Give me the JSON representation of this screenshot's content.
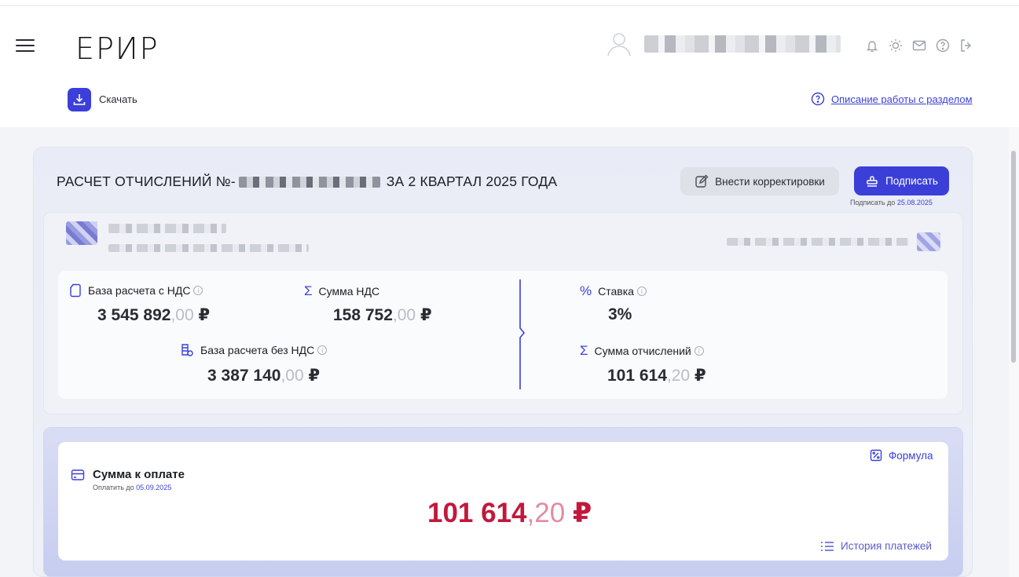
{
  "header": {
    "logo": "ЕРИР",
    "icons": [
      "bell-icon",
      "lightbulb-icon",
      "mail-icon",
      "help-icon",
      "logout-icon"
    ]
  },
  "actions": {
    "download_label": "Скачать",
    "help_link": "Описание работы с разделом"
  },
  "report": {
    "title_prefix": "РАСЧЕТ ОТЧИСЛЕНИЙ №-",
    "title_suffix": "ЗА 2 КВАРТАЛ 2025 ГОДА",
    "correct_button": "Внести корректировки",
    "sign_button": "Подписать",
    "sign_until_label": "Подписать до",
    "sign_until_date": "25.08.2025"
  },
  "calc": {
    "base_vat": {
      "label": "База расчета с НДС",
      "int": "3 545 892",
      "dec": ",00",
      "cur": " ₽"
    },
    "vat_sum": {
      "label": "Сумма НДС",
      "int": "158 752",
      "dec": ",00",
      "cur": " ₽"
    },
    "base_novat": {
      "label": "База расчета без НДС",
      "int": "3 387 140",
      "dec": ",00",
      "cur": " ₽"
    },
    "rate": {
      "label": "Ставка",
      "value": "3%"
    },
    "deductions": {
      "label": "Сумма отчислений",
      "int": "101 614",
      "dec": ",20",
      "cur": " ₽"
    }
  },
  "payment": {
    "title": "Сумма к оплате",
    "until_label": "Оплатить до",
    "until_date": "05.09.2025",
    "amount_int": "101 614",
    "amount_dec": ",20",
    "amount_cur": " ₽",
    "formula_link": "Формула",
    "history_link": "История платежей"
  },
  "colors": {
    "accent": "#3b3fd8",
    "amount": "#c2183c"
  }
}
